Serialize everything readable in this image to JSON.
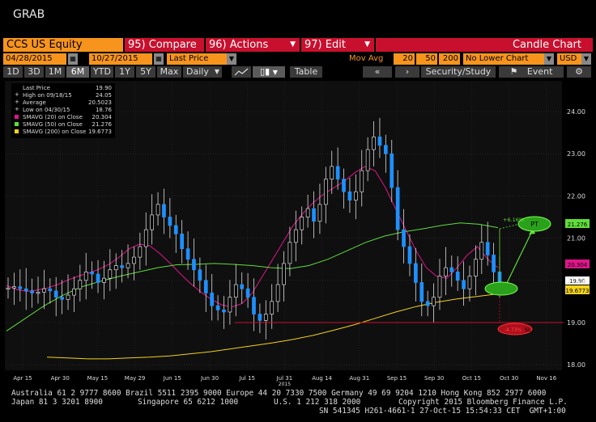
{
  "window": {
    "title": "GRAB"
  },
  "top_bar": {
    "security": "CCS US Equity",
    "compare": {
      "num": "95)",
      "label": "Compare"
    },
    "actions": {
      "num": "96)",
      "label": "Actions"
    },
    "edit": {
      "num": "97)",
      "label": "Edit"
    },
    "chart_type": "Candle Chart"
  },
  "params": {
    "start_date": "04/28/2015",
    "end_date": "10/27/2015",
    "field": "Last Price",
    "mov_avg_label": "Mov Avg",
    "mov_avg_1": "20",
    "mov_avg_2": "50",
    "mov_avg_3": "200",
    "lower_chart": "No Lower Chart",
    "currency": "USD"
  },
  "toolbar": {
    "periods": [
      "1D",
      "3D",
      "1M",
      "6M",
      "YTD",
      "1Y",
      "5Y",
      "Max"
    ],
    "active_period": "6M",
    "frequency": "Daily",
    "table": "Table",
    "security_study": "Security/Study",
    "event": "Event"
  },
  "legend": [
    {
      "label": "Last Price",
      "value": "19.90",
      "color": "#ffffff",
      "marker": "none"
    },
    {
      "label": "High on 09/18/15",
      "value": "24.05",
      "color": "#ffffff",
      "marker": "plus"
    },
    {
      "label": "Average",
      "value": "20.5023",
      "color": "#ffffff",
      "marker": "plus"
    },
    {
      "label": "Low on 04/30/15",
      "value": "18.76",
      "color": "#ffffff",
      "marker": "plus"
    },
    {
      "label": "SMAVG (20) on Close",
      "value": "20.304",
      "color": "#e0168a"
    },
    {
      "label": "SMAVG (50) on Close",
      "value": "21.276",
      "color": "#5fdc3c"
    },
    {
      "label": "SMAVG (200) on Close",
      "value": "19.6773",
      "color": "#f3d21b"
    }
  ],
  "annotations": {
    "pt": "PT",
    "pt_value": "+6.16%",
    "sl": "SL",
    "sl_value": "-4.73%"
  },
  "price_labels": {
    "sma50": "21.276",
    "sma20": "20.304",
    "last": "19.90",
    "sma200": "19.6773"
  },
  "chart_data": {
    "type": "line",
    "title": "",
    "y_ticks": [
      18.0,
      19.0,
      20.0,
      21.0,
      22.0,
      23.0,
      24.0
    ],
    "ylim": [
      17.8,
      24.2
    ],
    "x_ticks": [
      "Apr 15",
      "Apr 30",
      "May 15",
      "May 29",
      "Jun 15",
      "Jun 30",
      "Jul 15",
      "Jul 31",
      "Aug 14",
      "Aug 31",
      "Sep 15",
      "Sep 30",
      "Oct 15",
      "Oct 30",
      "Nov 16"
    ],
    "x_subtitle": "2015",
    "grid": true,
    "series": [
      {
        "name": "Last Price",
        "color": "#ffffff",
        "values": [
          19.82,
          19.85,
          19.8,
          19.75,
          19.7,
          19.72,
          19.8,
          19.75,
          19.6,
          19.55,
          19.65,
          19.8,
          20.0,
          20.2,
          20.15,
          19.95,
          20.05,
          20.25,
          20.35,
          20.3,
          20.4,
          20.55,
          20.8,
          21.2,
          21.55,
          21.8,
          21.5,
          21.3,
          21.1,
          20.75,
          20.5,
          20.25,
          20.0,
          19.7,
          19.4,
          19.3,
          19.25,
          19.6,
          19.9,
          19.8,
          19.6,
          19.2,
          19.05,
          19.2,
          19.5,
          19.9,
          20.4,
          20.9,
          21.2,
          21.5,
          21.7,
          21.4,
          21.8,
          22.4,
          22.7,
          22.4,
          22.1,
          21.9,
          22.1,
          22.6,
          23.1,
          23.4,
          23.2,
          23.0,
          22.2,
          21.2,
          20.8,
          20.4,
          19.95,
          19.5,
          19.4,
          19.6,
          20.1,
          20.3,
          20.2,
          20.0,
          19.8,
          20.1,
          20.5,
          20.9,
          20.6,
          20.2,
          19.9
        ]
      },
      {
        "name": "SMAVG (20) on Close",
        "color": "#e0168a",
        "values": [
          19.88,
          19.78,
          19.74,
          19.77,
          19.82,
          19.9,
          20.01,
          20.1,
          20.17,
          20.26,
          20.38,
          20.55,
          20.75,
          20.86,
          20.82,
          20.63,
          20.4,
          20.15,
          19.92,
          19.72,
          19.55,
          19.42,
          19.37,
          19.45,
          19.7,
          20.1,
          20.5,
          20.9,
          21.3,
          21.6,
          21.85,
          22.05,
          22.2,
          22.35,
          22.55,
          22.7,
          22.6,
          22.2,
          21.7,
          21.2,
          20.7,
          20.3,
          20.1,
          20.05,
          20.3,
          20.6,
          20.8,
          20.5,
          20.3
        ]
      },
      {
        "name": "SMAVG (50) on Close",
        "color": "#5fdc3c",
        "values": [
          18.8,
          19.1,
          19.4,
          19.65,
          19.85,
          19.98,
          20.1,
          20.2,
          20.3,
          20.37,
          20.38,
          20.4,
          20.38,
          20.35,
          20.3,
          20.28,
          20.35,
          20.5,
          20.7,
          20.9,
          21.05,
          21.15,
          21.22,
          21.3,
          21.36,
          21.33,
          21.25
        ]
      },
      {
        "name": "SMAVG (200) on Close",
        "color": "#f3d21b",
        "values": [
          18.18,
          18.16,
          18.14,
          18.14,
          18.16,
          18.18,
          18.21,
          18.26,
          18.31,
          18.38,
          18.45,
          18.52,
          18.6,
          18.7,
          18.82,
          18.95,
          19.1,
          19.25,
          19.38,
          19.48,
          19.56,
          19.62,
          19.68
        ]
      }
    ]
  },
  "footer": {
    "line1": "Australia 61 2 9777 8600 Brazil 5511 2395 9000 Europe 44 20 7330 7500 Germany 49 69 9204 1210 Hong Kong 852 2977 6000",
    "line2a": "Japan 81 3 3201 8900",
    "line2b": "Singapore 65 6212 1000",
    "line2c": "U.S. 1 212 318 2000",
    "line2d": "Copyright 2015 Bloomberg Finance L.P.",
    "line3": "SN 541345 H261-4661-1 27-Oct-15 15:54:33 CET  GMT+1:00"
  }
}
